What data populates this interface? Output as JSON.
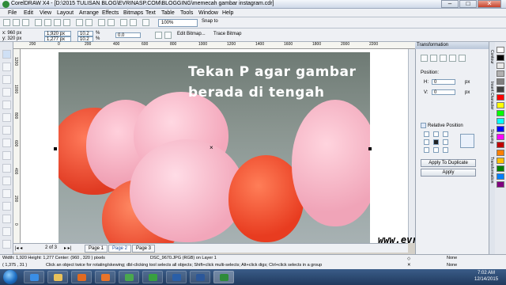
{
  "window": {
    "title": "CorelDRAW X4 - [D:\\2015 TULISAN BLOG\\EVRINASP.COM\\BLOGGING\\memecah gambar instagram.cdr]",
    "min": "–",
    "max": "□",
    "close": "✕"
  },
  "menu": [
    "File",
    "Edit",
    "View",
    "Layout",
    "Arrange",
    "Effects",
    "Bitmaps",
    "Text",
    "Table",
    "Tools",
    "Window",
    "Help"
  ],
  "toolbar": {
    "zoom": "100%",
    "snap": "Snap to"
  },
  "propbar": {
    "x": "x: 960 px",
    "y": "y: 320 px",
    "w": "1,920 px",
    "h": "1,277 px",
    "sx": "10.2",
    "sy": "10.2",
    "pct": "%",
    "angle": "0.0",
    "edit_bitmap": "Edit Bitmap...",
    "trace_bitmap": "Trace Bitmap"
  },
  "ruler_top": [
    "200",
    "0",
    "200",
    "400",
    "600",
    "800",
    "1000",
    "1200",
    "1400",
    "1600",
    "1800",
    "2000",
    "2200"
  ],
  "ruler_left": [
    "1200",
    "1000",
    "800",
    "600",
    "400",
    "200",
    "0"
  ],
  "overlay_text": {
    "line1": "Tekan P agar gambar",
    "line2": "berada di tengah"
  },
  "watermark": "www.evrinasp.com",
  "pages": {
    "counter": "2 of 3",
    "tabs": [
      "Page 1",
      "Page 2",
      "Page 3"
    ]
  },
  "docker": {
    "title": "Transformation",
    "position_label": "Position:",
    "h_label": "H:",
    "h_value": "0",
    "h_unit": "px",
    "v_label": "V:",
    "v_value": "0",
    "v_unit": "px",
    "relative": "Relative Position",
    "apply_dup": "Apply To Duplicate",
    "apply": "Apply"
  },
  "sidetabs": [
    "Contour",
    "Insert Character",
    "Shaping",
    "Transformation"
  ],
  "palette": [
    "#ffffff",
    "#000000",
    "#e8e8e8",
    "#b0b0b0",
    "#808080",
    "#404040",
    "#ff0000",
    "#ffff00",
    "#00ff00",
    "#00ffff",
    "#0000ff",
    "#ff00ff",
    "#c00000",
    "#ff8000",
    "#ffc000",
    "#008000",
    "#0080ff",
    "#800080"
  ],
  "status": {
    "size": "Width: 1,920  Height: 1,277  Center: (960 , 320 )  pixels",
    "obj": "DSC_9670.JPG (RGB) on Layer 1",
    "coords": "( 1,375 , 31 )",
    "hint": "Click an object twice for rotating/skewing; dbl-clicking tool selects all objects; Shift+click multi-selects; Alt+click digs; Ctrl+click selects in a group",
    "fill": "None",
    "outline": "None"
  },
  "clock": {
    "time": "7:02 AM",
    "date": "12/14/2015"
  }
}
